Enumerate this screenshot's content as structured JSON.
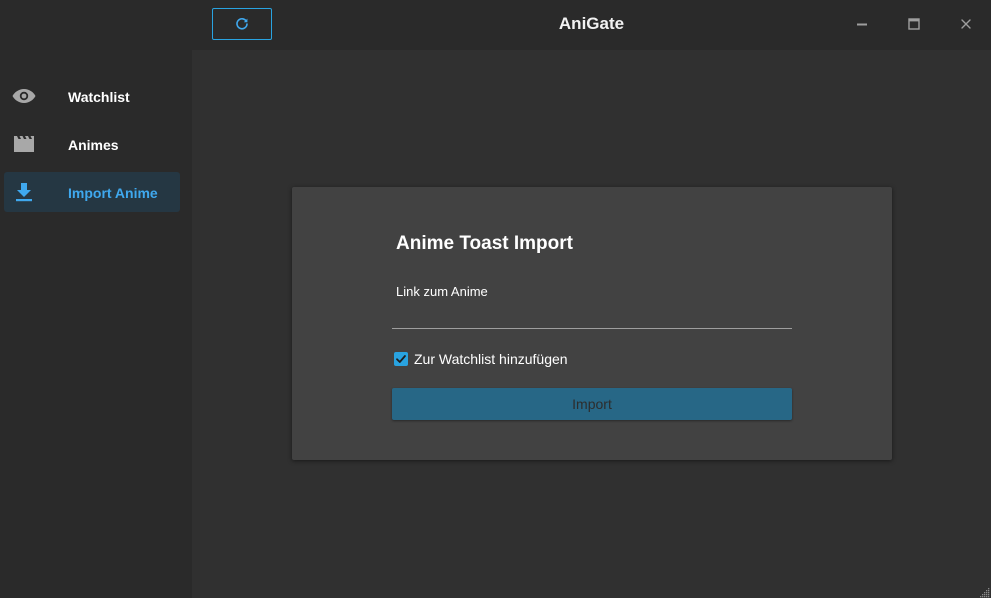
{
  "window": {
    "title": "AniGate"
  },
  "sidebar": {
    "items": [
      {
        "label": "Watchlist",
        "icon": "eye-icon",
        "active": false
      },
      {
        "label": "Animes",
        "icon": "clapperboard-icon",
        "active": false
      },
      {
        "label": "Import Anime",
        "icon": "download-icon",
        "active": true
      }
    ]
  },
  "toolbar": {
    "refresh_icon": "refresh-icon"
  },
  "import_form": {
    "title": "Anime Toast Import",
    "link_label": "Link zum Anime",
    "link_value": "",
    "watchlist_checkbox_label": "Zur Watchlist hinzufügen",
    "watchlist_checked": true,
    "import_button_label": "Import"
  },
  "colors": {
    "accent": "#29a3e0",
    "active_nav_bg": "#253743",
    "sidebar_bg": "#2a2a2a",
    "main_bg": "#303030",
    "card_bg": "#424242",
    "import_button_bg": "#276786"
  }
}
